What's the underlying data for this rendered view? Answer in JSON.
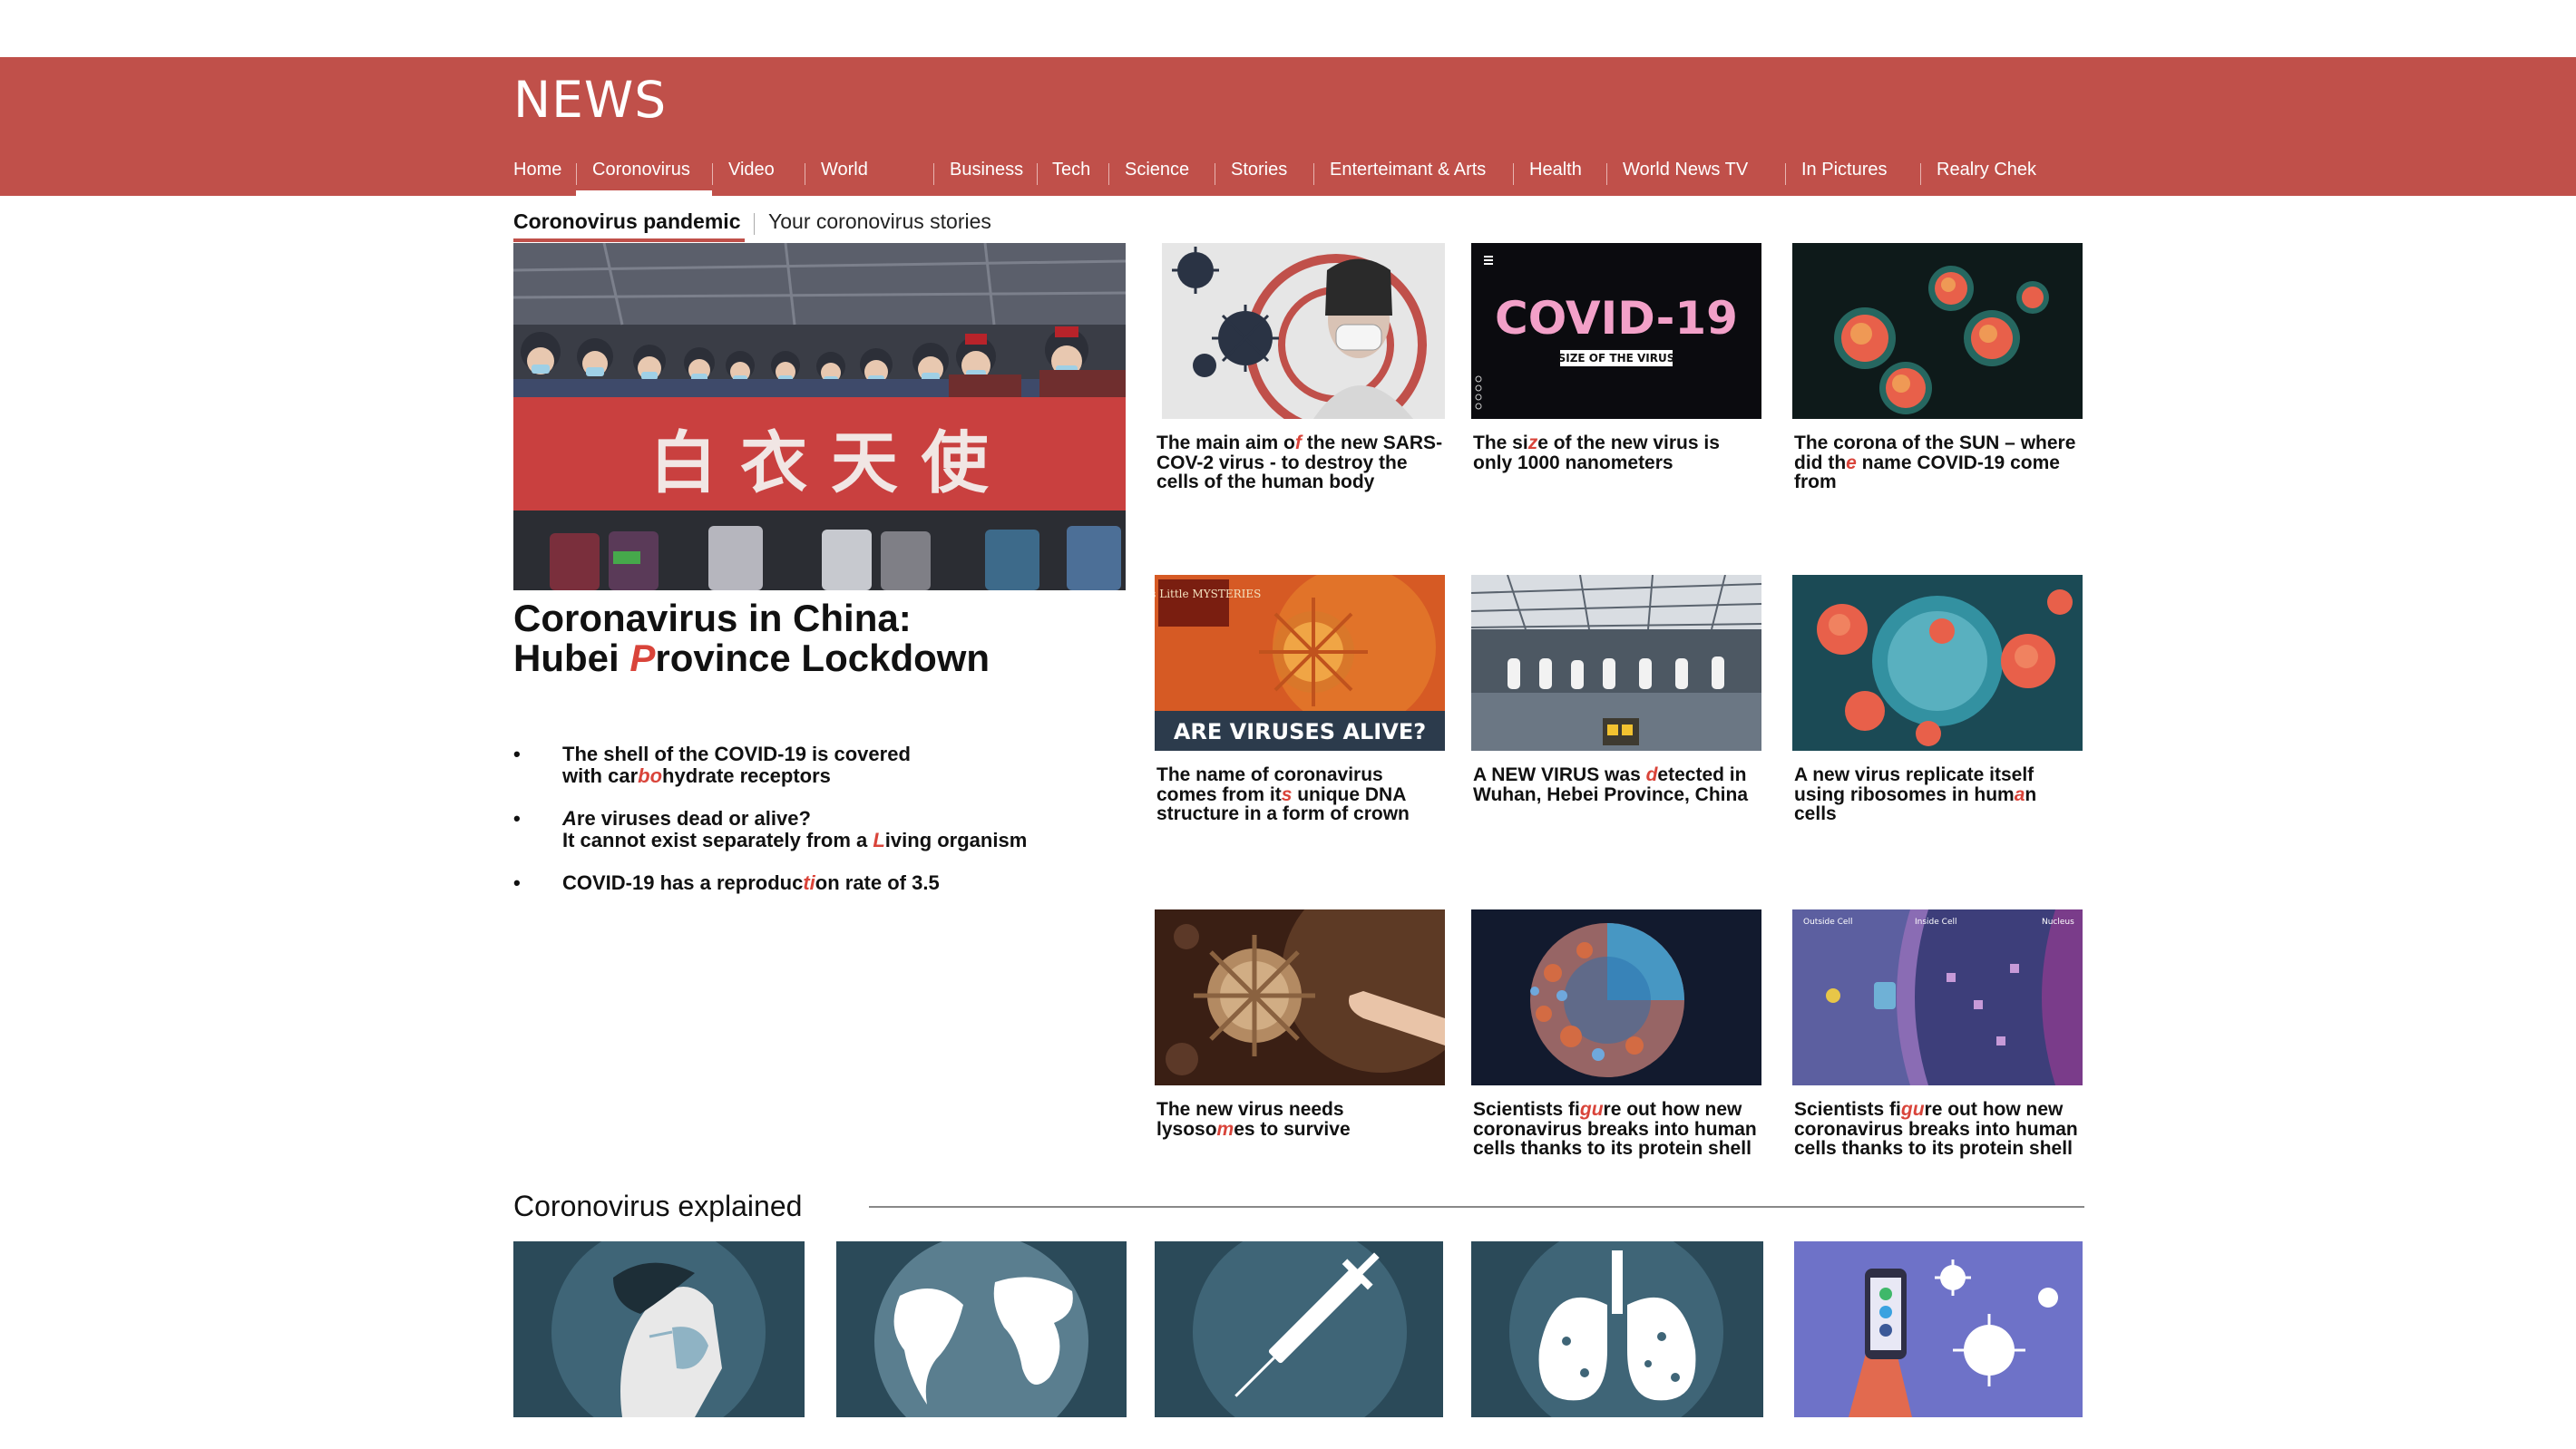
{
  "header": {
    "logo": "NEWS",
    "nav": [
      "Home",
      "Coronovirus",
      "Video",
      "World",
      "Business",
      "Tech",
      "Science",
      "Stories",
      "Enterteimant & Arts",
      "Health",
      "World News TV",
      "In Pictures",
      "Realry Chek"
    ],
    "active_nav": "Coronovirus",
    "brand_color": "#c0504a"
  },
  "subnav": {
    "active": "Coronovirus pandemic",
    "other": "Your coronovirus stories"
  },
  "hero": {
    "banner_text": "白 衣 天 使",
    "title_line1": "Coronavirus in China:",
    "title_line2_pre": "Hubei ",
    "title_line2_red": "P",
    "title_line2_post": "rovince Lockdown"
  },
  "bullets": [
    {
      "a": "The shell of the COVID-19  is covered",
      "b_pre": "with car",
      "b_red": "bo",
      "b_post": "hydrate receptors"
    },
    {
      "a_red": "A",
      "a": "re viruses dead or alive?",
      "b_pre": "It cannot exist separately from a ",
      "b_red": "L",
      "b_post": "iving organism"
    },
    {
      "a_pre": "COVID-19 has a reproduc",
      "a_red": "ti",
      "a_post": "on rate of 3.5"
    }
  ],
  "cards": [
    {
      "pre": "The main aim o",
      "red": "f",
      "post": " the new SARS-COV-2 virus  -  to destroy the cells of the human body"
    },
    {
      "pre": "The si",
      "red": "z",
      "post": "e of the new virus is only 1000 nanometers",
      "thumb_title": "COVID-19",
      "thumb_sub": "SIZE OF THE VIRUS"
    },
    {
      "pre": "The corona of the SUN – where did th",
      "red": "e",
      "post": " name COVID-19 come from"
    },
    {
      "pre": "The name of coronavirus comes from it",
      "red": "s",
      "post": " unique DNA structure in a form of crown",
      "thumb_title": "ARE VIRUSES ALIVE?",
      "thumb_sub": "Life's Little MYSTERIES"
    },
    {
      "pre": "A NEW VIRUS was ",
      "red": "d",
      "post": "etected in Wuhan, Hebei Province, China"
    },
    {
      "pre": "A new virus replicate itself using ribosomes in hum",
      "red": "a",
      "post": "n cells"
    },
    {
      "pre": "The new virus needs lysoso",
      "red": "m",
      "post": "es to survive"
    },
    {
      "pre": "Scientists fi",
      "red": "gu",
      "post": "re out how new coronavirus breaks into human cells thanks to its protein shell"
    },
    {
      "pre": "Scientists fi",
      "red": "gu",
      "post": "re out how new coronavirus breaks into human cells thanks to its protein shell",
      "thumb_labels": [
        "Outside Cell",
        "Inside Cell",
        "Nucleus"
      ]
    }
  ],
  "explained": {
    "title": "Coronovirus explained"
  }
}
